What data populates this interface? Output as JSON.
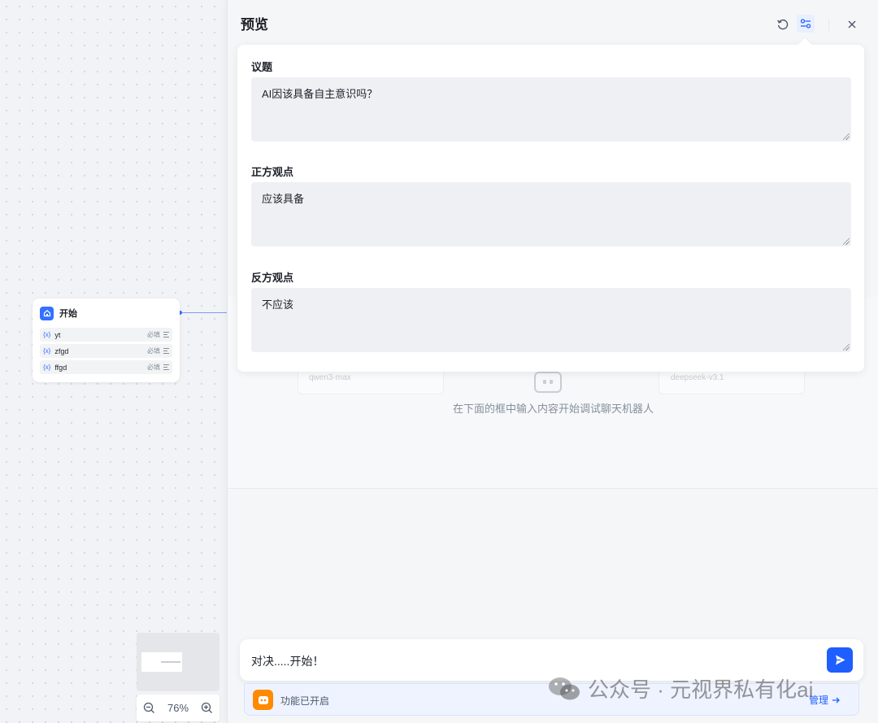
{
  "canvas": {
    "start_node": {
      "title": "开始",
      "variables": [
        {
          "prefix": "{x}",
          "name": "yt",
          "required": "必填"
        },
        {
          "prefix": "{x}",
          "name": "zfgd",
          "required": "必填"
        },
        {
          "prefix": "{x}",
          "name": "ffgd",
          "required": "必填"
        }
      ]
    },
    "zoom": {
      "level": "76%"
    }
  },
  "preview": {
    "title": "预览",
    "fields": [
      {
        "label": "议题",
        "value": "AI因该具备自主意识吗？"
      },
      {
        "label": "正方观点",
        "value": "应该具备"
      },
      {
        "label": "反方观点",
        "value": "不应该"
      }
    ],
    "chat": {
      "empty_hint": "在下面的框中输入内容开始调试聊天机器人",
      "ghost_models": [
        "qwen3-max",
        "deepseek-v3.1"
      ]
    },
    "input": {
      "value": "对决.....开始！"
    },
    "feature_bar": {
      "status": "功能已开启",
      "manage": "管理"
    }
  },
  "watermark": {
    "text": "公众号 · 元视界私有化ai"
  },
  "colors": {
    "accent": "#1f5eff",
    "feature_icon": "#ff8a00",
    "panel_bg": "#f5f6f8"
  }
}
